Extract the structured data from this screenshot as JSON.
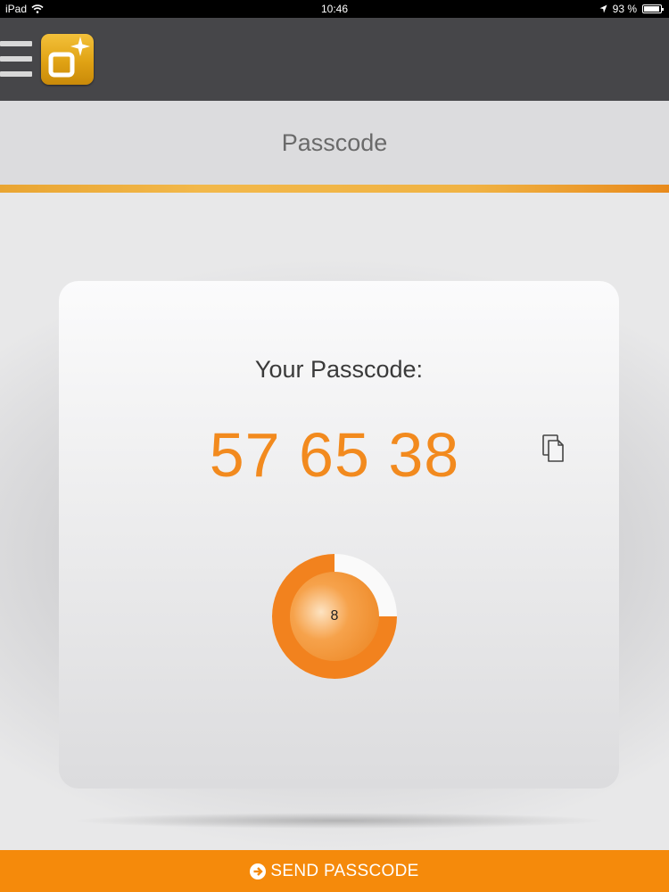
{
  "status_bar": {
    "device": "iPad",
    "time": "10:46",
    "battery_text": "93 %",
    "battery_level": 0.93,
    "icons": [
      "wifi-icon",
      "location-arrow-icon",
      "battery-icon"
    ]
  },
  "app_bar": {
    "menu_icon": "hamburger-menu-icon",
    "logo_icon": "app-logo-icon"
  },
  "page": {
    "title": "Passcode"
  },
  "card": {
    "label": "Your Passcode:",
    "passcode": "57 65 38",
    "copy_icon": "copy-icon",
    "timer": {
      "seconds_left": "8",
      "remaining_fraction": 0.75
    }
  },
  "send_button": {
    "label": "SEND PASSCODE",
    "icon": "arrow-circle-right-icon"
  },
  "colors": {
    "accent": "#f28a1e",
    "bottom_bar": "#f58a0b",
    "app_bar": "#464649",
    "logo": "#e0a214"
  }
}
